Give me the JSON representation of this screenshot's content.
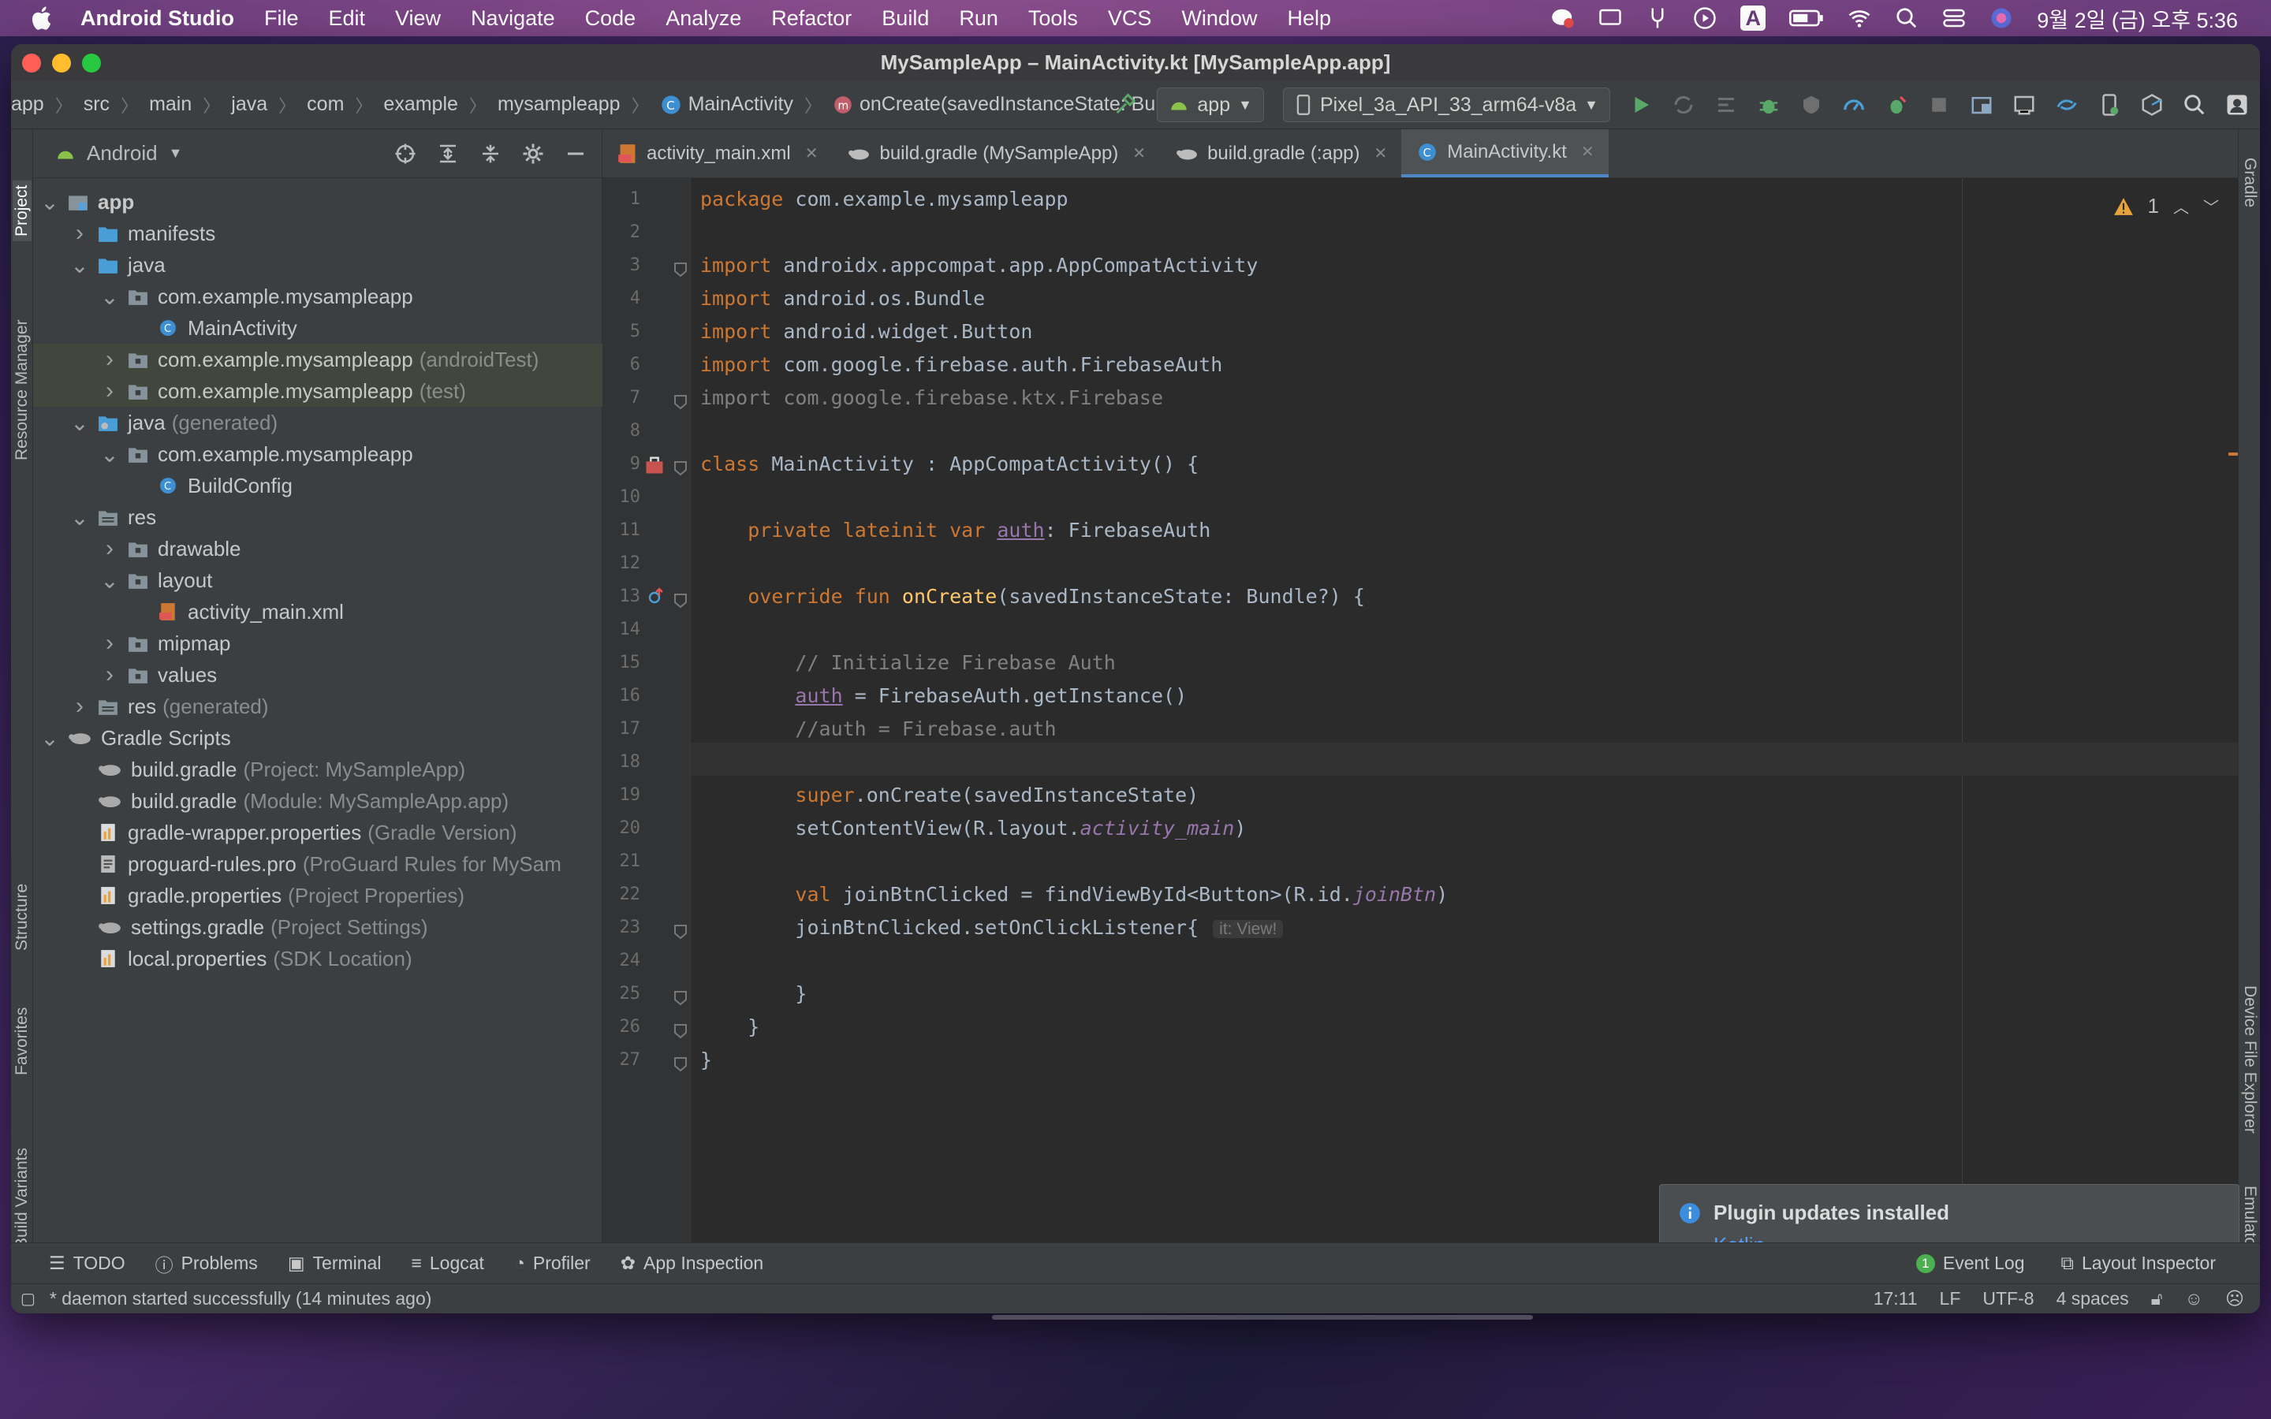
{
  "menubar": {
    "app": "Android Studio",
    "items": [
      "File",
      "Edit",
      "View",
      "Navigate",
      "Code",
      "Analyze",
      "Refactor",
      "Build",
      "Run",
      "Tools",
      "VCS",
      "Window",
      "Help"
    ],
    "clock": "9월 2일 (금) 오후 5:36",
    "input_source": "A"
  },
  "window": {
    "title": "MySampleApp – MainActivity.kt [MySampleApp.app]"
  },
  "breadcrumb": [
    "app",
    "src",
    "main",
    "java",
    "com",
    "example",
    "mysampleapp",
    "MainActivity",
    "onCreate(savedInstanceState: Bundle?)"
  ],
  "toolbar": {
    "run_config": "app",
    "device": "Pixel_3a_API_33_arm64-v8a"
  },
  "project": {
    "view_label": "Android",
    "tree": [
      {
        "label": "app",
        "sub": "",
        "bold": true
      },
      {
        "label": "manifests",
        "sub": ""
      },
      {
        "label": "java",
        "sub": ""
      },
      {
        "label": "com.example.mysampleapp",
        "sub": ""
      },
      {
        "label": "MainActivity",
        "sub": ""
      },
      {
        "label": "com.example.mysampleapp",
        "sub": "(androidTest)"
      },
      {
        "label": "com.example.mysampleapp",
        "sub": "(test)"
      },
      {
        "label": "java",
        "sub": "(generated)"
      },
      {
        "label": "com.example.mysampleapp",
        "sub": ""
      },
      {
        "label": "BuildConfig",
        "sub": ""
      },
      {
        "label": "res",
        "sub": ""
      },
      {
        "label": "drawable",
        "sub": ""
      },
      {
        "label": "layout",
        "sub": ""
      },
      {
        "label": "activity_main.xml",
        "sub": ""
      },
      {
        "label": "mipmap",
        "sub": ""
      },
      {
        "label": "values",
        "sub": ""
      },
      {
        "label": "res",
        "sub": "(generated)"
      },
      {
        "label": "Gradle Scripts",
        "sub": ""
      },
      {
        "label": "build.gradle",
        "sub": "(Project: MySampleApp)"
      },
      {
        "label": "build.gradle",
        "sub": "(Module: MySampleApp.app)"
      },
      {
        "label": "gradle-wrapper.properties",
        "sub": "(Gradle Version)"
      },
      {
        "label": "proguard-rules.pro",
        "sub": "(ProGuard Rules for MySam"
      },
      {
        "label": "gradle.properties",
        "sub": "(Project Properties)"
      },
      {
        "label": "settings.gradle",
        "sub": "(Project Settings)"
      },
      {
        "label": "local.properties",
        "sub": "(SDK Location)"
      }
    ]
  },
  "left_tools": [
    "Project",
    "Resource Manager",
    "Structure",
    "Favorites",
    "Build Variants"
  ],
  "right_tools": [
    "Gradle",
    "Device File Explorer",
    "Emulator"
  ],
  "tabs": [
    "activity_main.xml",
    "build.gradle (MySampleApp)",
    "build.gradle (:app)",
    "MainActivity.kt"
  ],
  "editor": {
    "warning_count": "1",
    "line_numbers": [
      "1",
      "2",
      "3",
      "4",
      "5",
      "6",
      "7",
      "8",
      "9",
      "10",
      "11",
      "12",
      "13",
      "14",
      "15",
      "16",
      "17",
      "18",
      "19",
      "20",
      "21",
      "22",
      "23",
      "24",
      "25",
      "26",
      "27"
    ],
    "lines": [
      "package com.example.mysampleapp",
      "",
      "import androidx.appcompat.app.AppCompatActivity",
      "import android.os.Bundle",
      "import android.widget.Button",
      "import com.google.firebase.auth.FirebaseAuth",
      "import com.google.firebase.ktx.Firebase",
      "",
      "class MainActivity : AppCompatActivity() {",
      "",
      "    private lateinit var auth: FirebaseAuth",
      "",
      "    override fun onCreate(savedInstanceState: Bundle?) {",
      "",
      "        // Initialize Firebase Auth",
      "        auth = FirebaseAuth.getInstance()",
      "        //auth = Firebase.auth",
      "",
      "        super.onCreate(savedInstanceState)",
      "        setContentView(R.layout.activity_main)",
      "",
      "        val joinBtnClicked = findViewById<Button>(R.id.joinBtn)",
      "        joinBtnClicked.setOnClickListener{",
      "",
      "        }",
      "    }",
      "}"
    ],
    "param_hint": "it: View!"
  },
  "notification": {
    "title": "Plugin updates installed",
    "link": "Kotlin"
  },
  "bottom_tools": [
    "TODO",
    "Problems",
    "Terminal",
    "Logcat",
    "Profiler",
    "App Inspection"
  ],
  "bottom_right": [
    "Event Log",
    "Layout Inspector"
  ],
  "event_count": "1",
  "status": {
    "message": "* daemon started successfully (14 minutes ago)",
    "position": "17:11",
    "line_sep": "LF",
    "encoding": "UTF-8",
    "indent": "4 spaces"
  }
}
